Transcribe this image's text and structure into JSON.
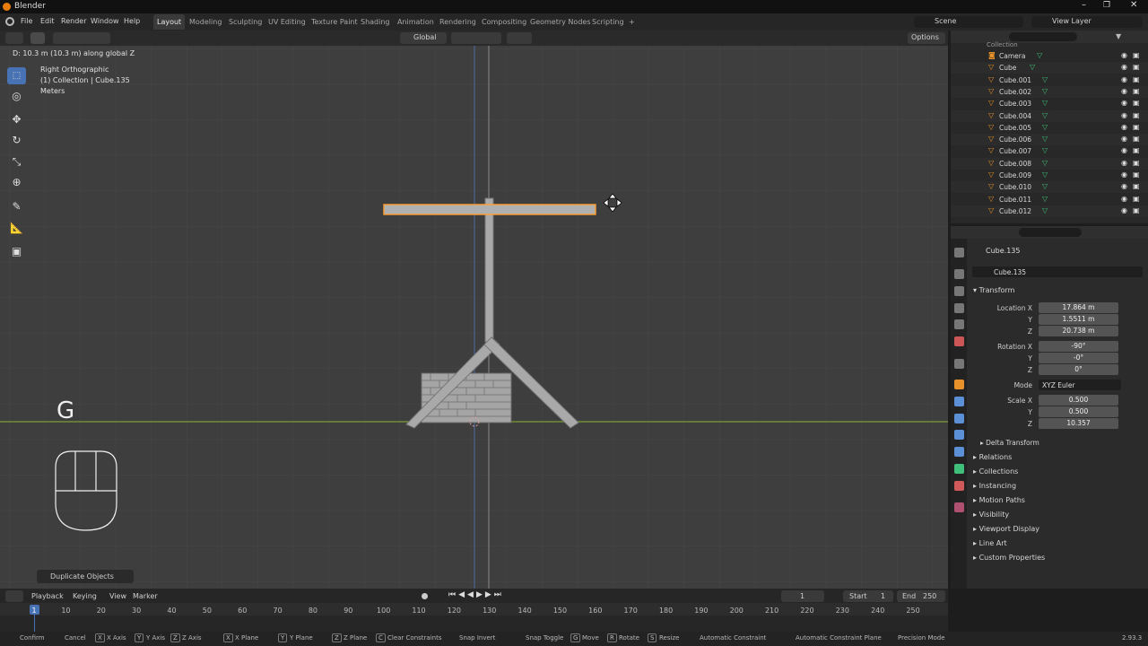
{
  "app": {
    "title": "Blender",
    "version": "2.93.3"
  },
  "menu": [
    "File",
    "Edit",
    "Render",
    "Window",
    "Help"
  ],
  "workspaces": [
    "Layout",
    "Modeling",
    "Sculpting",
    "UV Editing",
    "Texture Paint",
    "Shading",
    "Animation",
    "Rendering",
    "Compositing",
    "Geometry Nodes",
    "Scripting"
  ],
  "workspace_add": "+",
  "scene": {
    "name": "Scene",
    "view_layer": "View Layer"
  },
  "viewport": {
    "status_text": "D: 10.3 m (10.3 m) along global Z",
    "view_name": "Right Orthographic",
    "collection_info": "(1) Collection | Cube.135",
    "units": "Meters",
    "key_overlay": "G",
    "orientation": "Global",
    "options_label": "Options",
    "operator_panel": "Duplicate Objects"
  },
  "outliner": {
    "top_item": "Collection",
    "items": [
      "Camera",
      "Cube",
      "Cube.001",
      "Cube.002",
      "Cube.003",
      "Cube.004",
      "Cube.005",
      "Cube.006",
      "Cube.007",
      "Cube.008",
      "Cube.009",
      "Cube.010",
      "Cube.011",
      "Cube.012"
    ]
  },
  "properties": {
    "object_name": "Cube.135",
    "data_name": "Cube.135",
    "transform_label": "Transform",
    "location": {
      "label": "Location X",
      "x": "17.864 m",
      "y": "1.5511 m",
      "z": "20.738 m"
    },
    "rotation": {
      "label": "Rotation X",
      "x": "-90°",
      "y": "-0°",
      "z": "0°"
    },
    "mode_label": "Mode",
    "mode_value": "XYZ Euler",
    "scale": {
      "label": "Scale X",
      "x": "0.500",
      "y": "0.500",
      "z": "10.357"
    },
    "axis_y": "Y",
    "axis_z": "Z",
    "delta_transform": "Delta Transform",
    "panels": [
      "Relations",
      "Collections",
      "Instancing",
      "Motion Paths",
      "Visibility",
      "Viewport Display",
      "Line Art",
      "Custom Properties"
    ]
  },
  "timeline": {
    "menus": [
      "Playback",
      "Keying",
      "View",
      "Marker"
    ],
    "current_frame": "1",
    "start_label": "Start",
    "start": "1",
    "end_label": "End",
    "end": "250",
    "ruler": [
      "1",
      "10",
      "20",
      "30",
      "40",
      "50",
      "60",
      "70",
      "80",
      "90",
      "100",
      "110",
      "120",
      "130",
      "140",
      "150",
      "160",
      "170",
      "180",
      "190",
      "200",
      "210",
      "220",
      "230",
      "240",
      "250"
    ]
  },
  "statusbar": [
    "Confirm",
    "Cancel",
    "X Axis",
    "Y Axis",
    "Z Axis",
    "X Plane",
    "Y Plane",
    "Z Plane",
    "Clear Constraints",
    "Snap Invert",
    "Snap Toggle",
    "Move",
    "Rotate",
    "Resize",
    "Automatic Constraint",
    "Automatic Constraint Plane",
    "Precision Mode"
  ],
  "status_keys": [
    "X",
    "Y",
    "Z",
    "X",
    "Y",
    "Z",
    "C",
    "G",
    "R",
    "S"
  ],
  "colors": {
    "accent": "#4772b3",
    "x_axis": "#8fb23a",
    "selected_outline": "#ffa030",
    "viewport_bg": "#3e3e3e"
  },
  "icons": [
    "blender-logo-icon",
    "select-box-icon",
    "cursor-icon",
    "move-icon",
    "rotate-icon",
    "scale-icon",
    "transform-icon",
    "annotate-icon",
    "measure-icon",
    "add-cube-icon",
    "eye-icon",
    "camera-icon",
    "mesh-icon",
    "play-icon",
    "filter-icon",
    "search-icon"
  ]
}
